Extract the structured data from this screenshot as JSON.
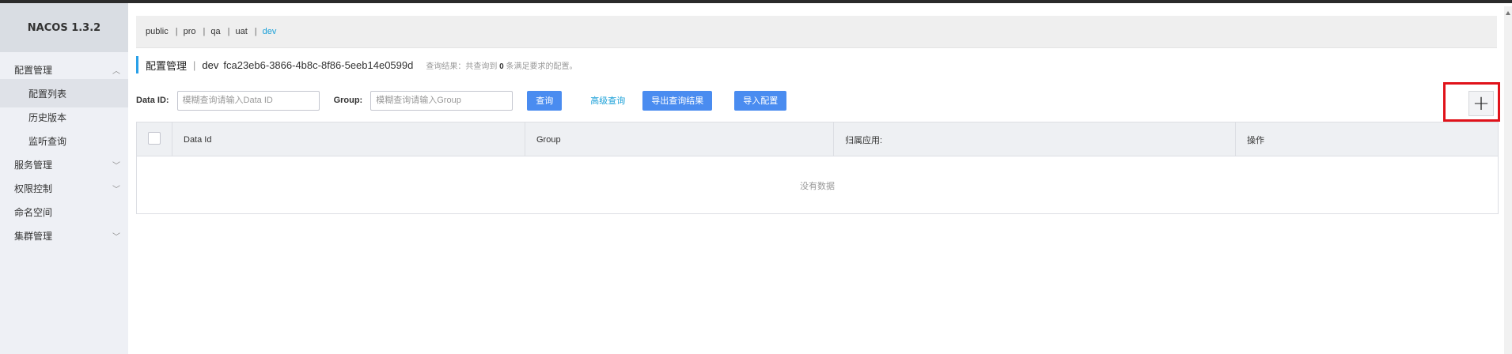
{
  "app": {
    "title": "NACOS 1.3.2"
  },
  "sidebar": {
    "items": [
      {
        "label": "配置管理",
        "chevron": "up"
      },
      {
        "label": "配置列表",
        "active": true
      },
      {
        "label": "历史版本"
      },
      {
        "label": "监听查询"
      },
      {
        "label": "服务管理",
        "chevron": "down"
      },
      {
        "label": "权限控制",
        "chevron": "down"
      },
      {
        "label": "命名空间"
      },
      {
        "label": "集群管理",
        "chevron": "down"
      }
    ]
  },
  "namespaces": {
    "items": [
      "public",
      "pro",
      "qa",
      "uat",
      "dev"
    ],
    "separator": "|",
    "active": "dev"
  },
  "header": {
    "title": "配置管理",
    "separator": "|",
    "namespace": "dev",
    "namespace_id": "fca23eb6-3866-4b8c-8f86-5eeb14e0599d",
    "result_prefix": "查询结果：共查询到",
    "result_count": "0",
    "result_suffix": "条满足要求的配置。"
  },
  "filter": {
    "data_id_label": "Data ID:",
    "data_id_placeholder": "模糊查询请输入Data ID",
    "group_label": "Group:",
    "group_placeholder": "模糊查询请输入Group",
    "search_button": "查询",
    "advanced_link": "高级查询",
    "export_button": "导出查询结果",
    "import_button": "导入配置"
  },
  "add_button": {
    "symbol": "+"
  },
  "table": {
    "columns": [
      "Data Id",
      "Group",
      "归属应用:",
      "操作"
    ],
    "empty_text": "没有数据"
  },
  "colors": {
    "accent": "#4a8cf0",
    "link": "#1aa0d8",
    "highlight": "#e0121a"
  }
}
